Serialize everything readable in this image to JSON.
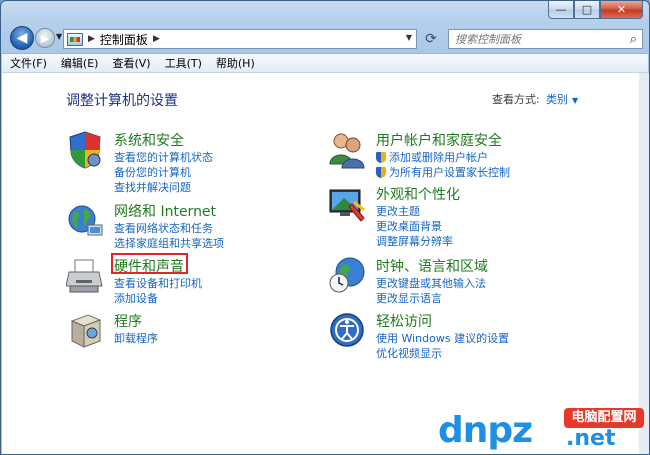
{
  "window": {
    "caption_buttons": {
      "minimize": "—",
      "maximize": "□",
      "close": "✕"
    }
  },
  "nav": {
    "back_glyph": "◀",
    "forward_glyph": "▶",
    "breadcrumb": "控制面板",
    "search_placeholder": "搜索控制面板",
    "icons": [
      "back-icon",
      "forward-icon",
      "refresh-icon",
      "search-icon"
    ]
  },
  "menu": [
    "文件(F)",
    "编辑(E)",
    "查看(V)",
    "工具(T)",
    "帮助(H)"
  ],
  "content": {
    "heading": "调整计算机的设置",
    "view_by_label": "查看方式:",
    "view_by_value": "类别"
  },
  "categories": [
    {
      "id": "system-security",
      "icon": "security-shield-icon",
      "title": "系统和安全",
      "links": [
        "查看您的计算机状态",
        "备份您的计算机",
        "查找并解决问题"
      ]
    },
    {
      "id": "network-internet",
      "icon": "network-globe-icon",
      "title": "网络和 Internet",
      "links": [
        "查看网络状态和任务",
        "选择家庭组和共享选项"
      ]
    },
    {
      "id": "hardware-sound",
      "icon": "printer-icon",
      "title": "硬件和声音",
      "links": [
        "查看设备和打印机",
        "添加设备"
      ]
    },
    {
      "id": "programs",
      "icon": "programs-box-icon",
      "title": "程序",
      "links": [
        "卸载程序"
      ]
    },
    {
      "id": "user-accounts",
      "icon": "users-icon",
      "title": "用户帐户和家庭安全",
      "links": [
        "添加或删除用户帐户",
        "为所有用户设置家长控制"
      ]
    },
    {
      "id": "appearance",
      "icon": "appearance-monitor-icon",
      "title": "外观和个性化",
      "links": [
        "更改主题",
        "更改桌面背景",
        "调整屏幕分辨率"
      ]
    },
    {
      "id": "clock-region",
      "icon": "clock-globe-icon",
      "title": "时钟、语言和区域",
      "links": [
        "更改键盘或其他输入法",
        "更改显示语言"
      ]
    },
    {
      "id": "ease-access",
      "icon": "ease-of-access-icon",
      "title": "轻松访问",
      "links": [
        "使用 Windows 建议的设置",
        "优化视频显示"
      ]
    }
  ],
  "watermark": {
    "brand": "dnpz",
    "tag": "电脑配置网",
    "domain": ".net"
  },
  "colors": {
    "link": "#1565c4",
    "category_title": "#1e7b1e",
    "heading": "#1e3287",
    "highlight": "#e02626"
  }
}
